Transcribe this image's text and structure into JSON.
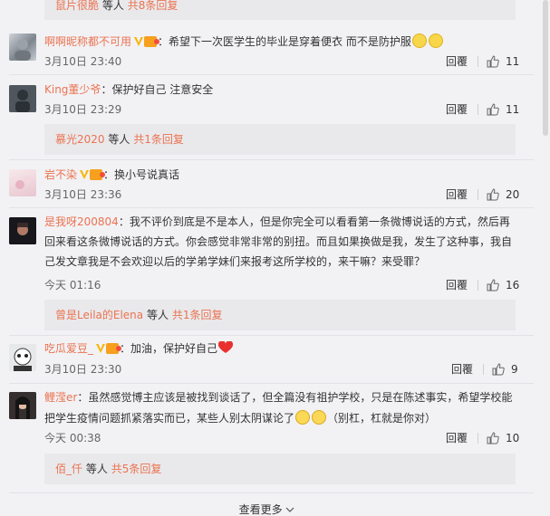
{
  "top_reply": {
    "user": "鼠片很脆",
    "text": "等人",
    "count": "共8条回复"
  },
  "comments": [
    {
      "user": "啊啊昵称都不可用",
      "text": "：希望下一次医学生的毕业是穿着便衣 而不是防护服",
      "date": "3月10日 23:40",
      "reply_label": "回覆",
      "likes": "11"
    },
    {
      "user": "King董少爷",
      "text": "：保护好自己 注意安全",
      "date": "3月10日 23:29",
      "reply_label": "回覆",
      "likes": "11",
      "sub": {
        "user": "慕光2020",
        "text": "等人",
        "count": "共1条回复"
      }
    },
    {
      "user": "岩不染",
      "text": "：换小号说真话",
      "date": "3月10日 23:36",
      "reply_label": "回覆",
      "likes": "20"
    },
    {
      "user": "是我呀200804",
      "text_line1": "：我不评价到底是不是本人，但是你完全可以看看第一条微博说话的方式，然后再",
      "text_line2": "回来看这条微博说话的方式。你会感觉非常非常的别扭。而且如果换做是我，发生了这种事，我自",
      "text_line3": "己发文章我是不会欢迎以后的学弟学妹们来报考这所学校的，来干嘛？来受罪？",
      "date": "今天 01:16",
      "reply_label": "回覆",
      "likes": "16",
      "sub": {
        "user": "曾是Leila的Elena",
        "text": "等人",
        "count": "共1条回复"
      }
    },
    {
      "user": "吃瓜爱豆_",
      "text": "：加油，保护好自己",
      "date": "3月10日 23:30",
      "reply_label": "回覆",
      "likes": "9"
    },
    {
      "user": "鲤滢er",
      "text_line1": "：虽然感觉博主应该是被找到谈话了，但全篇没有祖护学校，只是在陈述事实，希望学校能",
      "text_line2a": "把学生疫情问题抓紧落实而已，某些人别太阴谋论了",
      "text_line2b": "（别杠，杠就是你对）",
      "date": "今天 00:38",
      "reply_label": "回覆",
      "likes": "10",
      "sub": {
        "user": "佰_仟",
        "text": "等人",
        "count": "共5条回复"
      }
    }
  ],
  "more_label": "查看更多",
  "colors": {
    "accent": "#eb7350",
    "bg": "#f2f2f5",
    "reply_bg": "#e9e9ec"
  },
  "icons": [
    "vip-icon",
    "medal-icon",
    "like-icon",
    "chevron-down-icon",
    "cry-emoji",
    "heart-emoji",
    "smile-emoji"
  ]
}
